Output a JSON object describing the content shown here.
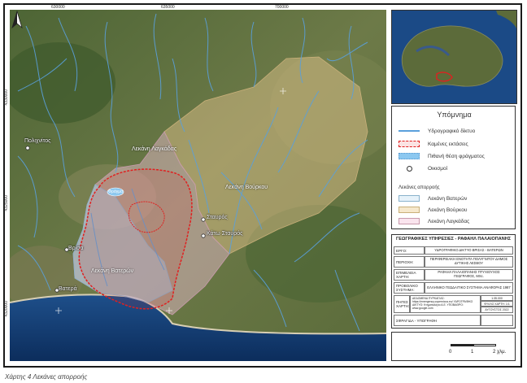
{
  "map": {
    "grid": {
      "top": [
        "630000",
        "635000",
        "700000"
      ],
      "left": [
        "4330000",
        "4325000",
        "4320000"
      ]
    },
    "places": {
      "polichnitos": "Πολιχνίτος",
      "vrisa": "Βρίσα",
      "vatera": "Βατερά",
      "stavros": "Σταυρός",
      "kato_stavros": "Κάτω Σταυρός"
    },
    "basins": {
      "lagkada": "Λεκάνη Λαγκάδας",
      "vourkos": "Λεκάνη Βούρκου",
      "vateron": "Λεκάνη Βατερών"
    },
    "dam": "Φράγμα"
  },
  "legend": {
    "title": "Υπόμνημα",
    "items": [
      "Υδρογραφικό δίκτυο",
      "Καμένες εκτάσεις",
      "Πιθανή θέση φράγματος",
      "Οικισμοί"
    ],
    "subtitle": "Λεκάνες απορροής",
    "basins": [
      "Λεκάνη Βατερών",
      "Λεκάνη Βούρκου",
      "Λεκάνη Λαγκάδας"
    ],
    "colors": {
      "river": "#5aa0dc",
      "burned": "#e02020",
      "dam": "#8cc8f0",
      "vateron": "#a8d0ec",
      "vourkos": "#e8c890",
      "lagkada": "#f0c0d4"
    }
  },
  "info": {
    "title": "ΓΕΩΓΡΑΦΙΚΕΣ ΥΠΗΡΕΣΙΕΣ - ΡΑΦΑΗΛ ΠΑΛΑΙΟΠΑΝΗΣ",
    "rows": [
      {
        "label": "ΕΡΓΟ:",
        "value": "ΥΔΡΟΓΡΑΦΙΚΟ ΔΙΚΤΥΟ ΒΡΙΣΑΣ - ΒΑΤΕΡΩΝ"
      },
      {
        "label": "ΠΕΡΙΟΧΗ:",
        "value": "ΠΕΡΙΦΕΡΕΙΑΚΗ ΕΝΟΤΗΤΑ ΠΟΛΥΓΝΙΤΟΥ ΔΗΜΟΣ ΔΥΤΙΚΗΣ ΛΕΣΒΟΥ"
      },
      {
        "label": "ΕΠΙΜΕΛΕΙΑ ΧΑΡΤΗ:",
        "value": "ΡΑΦΑΗΛ ΠΑΛΑΙΟΠΑΝΗΣ ΠΤΥΧΙΟΥΧΟΣ ΓΕΩΓΡΑΦΟΣ, MSc."
      },
      {
        "label": "ΠΡΟΒΟΛΙΚΟ ΣΥΣΤΗΜΑ:",
        "value": "ΕΛΛΗΝΙΚΟ ΓΕΩΔΑΙΤΙΚΟ ΣΥΣΤΗΜΑ ΑΝΑΦΟΡΑΣ 1987"
      },
      {
        "label": "ΠΗΓΕΣ ΧΑΡΤΗ:",
        "value": "ΔΕΔΟΜΕΝΑ ΠΥΡΚΑΓΙΑΣ: https://emergency.copernicus.eu/ ΥΔΡΟΓΡΑΦΙΚΟ ΔΙΚΤΥΟ: Κτηματολόγιο Α.Ε. ΥΠΟΒΑΘΡΟ: www.google.com"
      },
      {
        "label": "ΣΦΡΑΓΙΔΑ - ΥΠΟΓΡΑΦΗ",
        "value": ""
      }
    ],
    "side_values": [
      "1:35.000",
      "ΦΥΛΛΟ ΧΑΡΤΗ: 1/1",
      "ΑΥΓΟΥΣΤΟΣ 2022"
    ]
  },
  "scalebar": {
    "labels": [
      "0",
      "1",
      "2 χλμ."
    ]
  },
  "caption": "Χάρτης 4 Λεκάνες απορροής"
}
